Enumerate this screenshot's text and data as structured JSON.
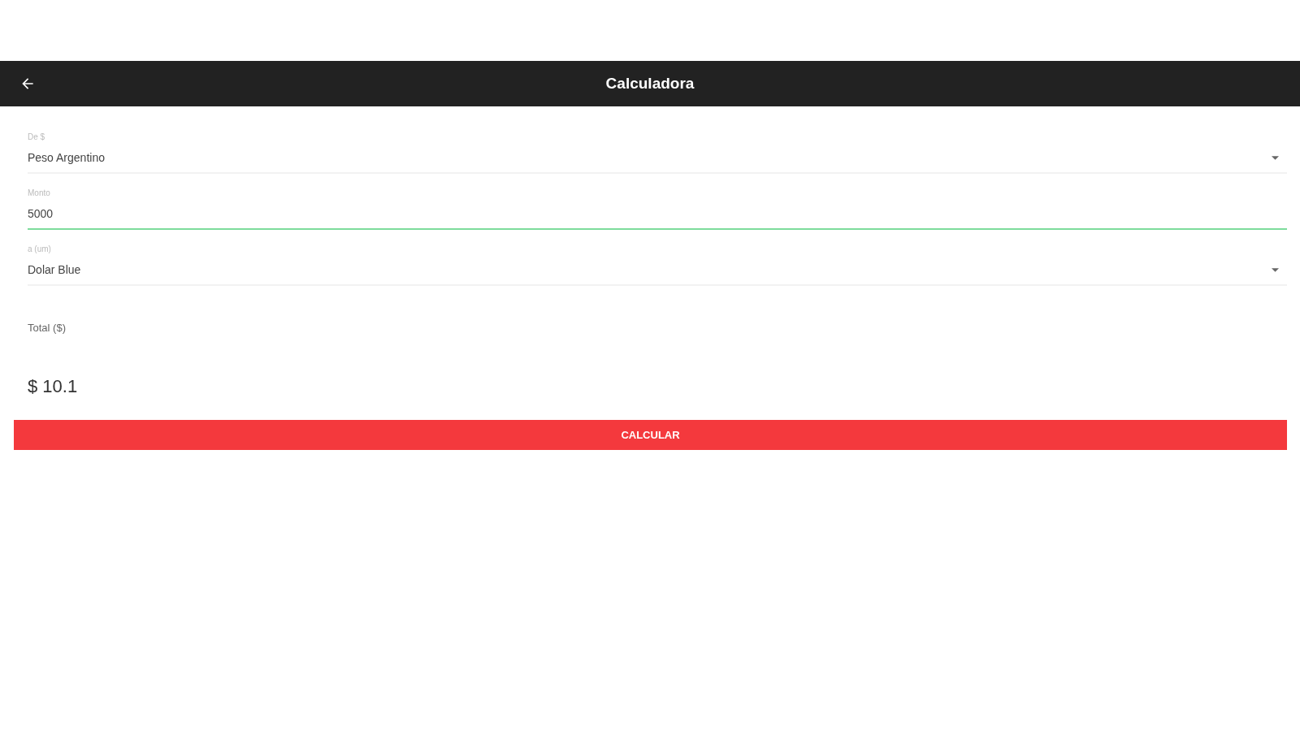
{
  "app_bar": {
    "title": "Calculadora"
  },
  "fields": [
    {
      "kind": "select",
      "label": "De $",
      "value": "Peso Argentino",
      "focused": false
    },
    {
      "kind": "input",
      "label": "Monto",
      "value": "5000",
      "focused": true
    },
    {
      "kind": "select",
      "label": "a (um)",
      "value": "Dolar Blue",
      "focused": false
    }
  ],
  "total": {
    "label": "Total ($)",
    "value": "$ 10.1"
  },
  "button": "CALCULAR"
}
